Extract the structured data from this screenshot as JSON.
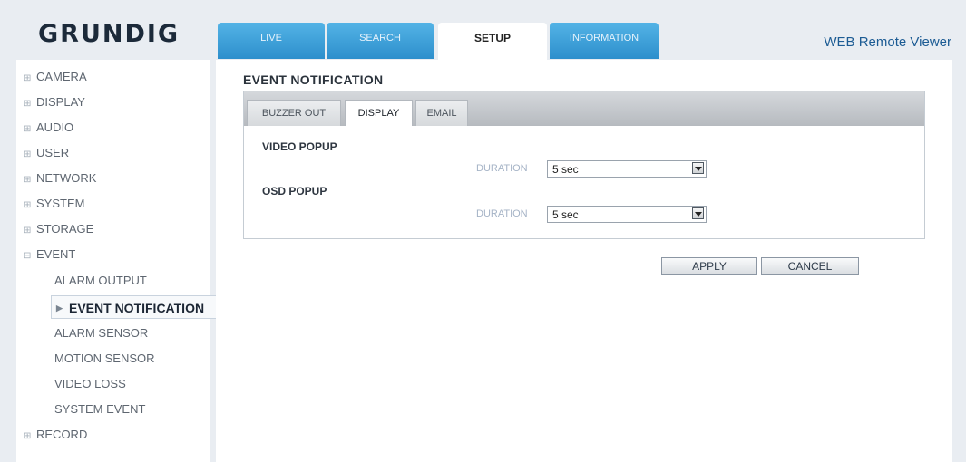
{
  "brand": {
    "logo": "GRUNDIG",
    "viewer_title": "WEB Remote Viewer"
  },
  "tabs": [
    {
      "label": "LIVE",
      "active": false
    },
    {
      "label": "SEARCH",
      "active": false
    },
    {
      "label": "SETUP",
      "active": true
    },
    {
      "label": "INFORMATION",
      "active": false
    }
  ],
  "sidebar": {
    "items": [
      {
        "label": "CAMERA",
        "icon": "plus-box-icon"
      },
      {
        "label": "DISPLAY",
        "icon": "plus-box-icon"
      },
      {
        "label": "AUDIO",
        "icon": "plus-box-icon"
      },
      {
        "label": "USER",
        "icon": "plus-box-icon"
      },
      {
        "label": "NETWORK",
        "icon": "plus-box-icon"
      },
      {
        "label": "SYSTEM",
        "icon": "plus-box-icon"
      },
      {
        "label": "STORAGE",
        "icon": "plus-box-icon"
      },
      {
        "label": "EVENT",
        "icon": "minus-box-icon"
      },
      {
        "label": "RECORD",
        "icon": "plus-box-icon"
      }
    ],
    "event_children": [
      {
        "label": "ALARM OUTPUT"
      },
      {
        "label": "EVENT NOTIFICATION",
        "active": true
      },
      {
        "label": "ALARM SENSOR"
      },
      {
        "label": "MOTION SENSOR"
      },
      {
        "label": "VIDEO LOSS"
      },
      {
        "label": "SYSTEM EVENT"
      }
    ]
  },
  "main": {
    "title": "EVENT NOTIFICATION",
    "subtabs": [
      {
        "label": "BUZZER OUT",
        "active": false
      },
      {
        "label": "DISPLAY",
        "active": true
      },
      {
        "label": "EMAIL",
        "active": false
      }
    ],
    "video_popup": {
      "heading": "VIDEO POPUP",
      "duration_label": "DURATION",
      "duration_value": "5 sec"
    },
    "osd_popup": {
      "heading": "OSD POPUP",
      "duration_label": "DURATION",
      "duration_value": "5 sec"
    },
    "apply_label": "APPLY",
    "cancel_label": "CANCEL"
  },
  "colors": {
    "tab_blue": "#3a9fd8",
    "background": "#e9edf2",
    "title_blue": "#1d5c94"
  }
}
